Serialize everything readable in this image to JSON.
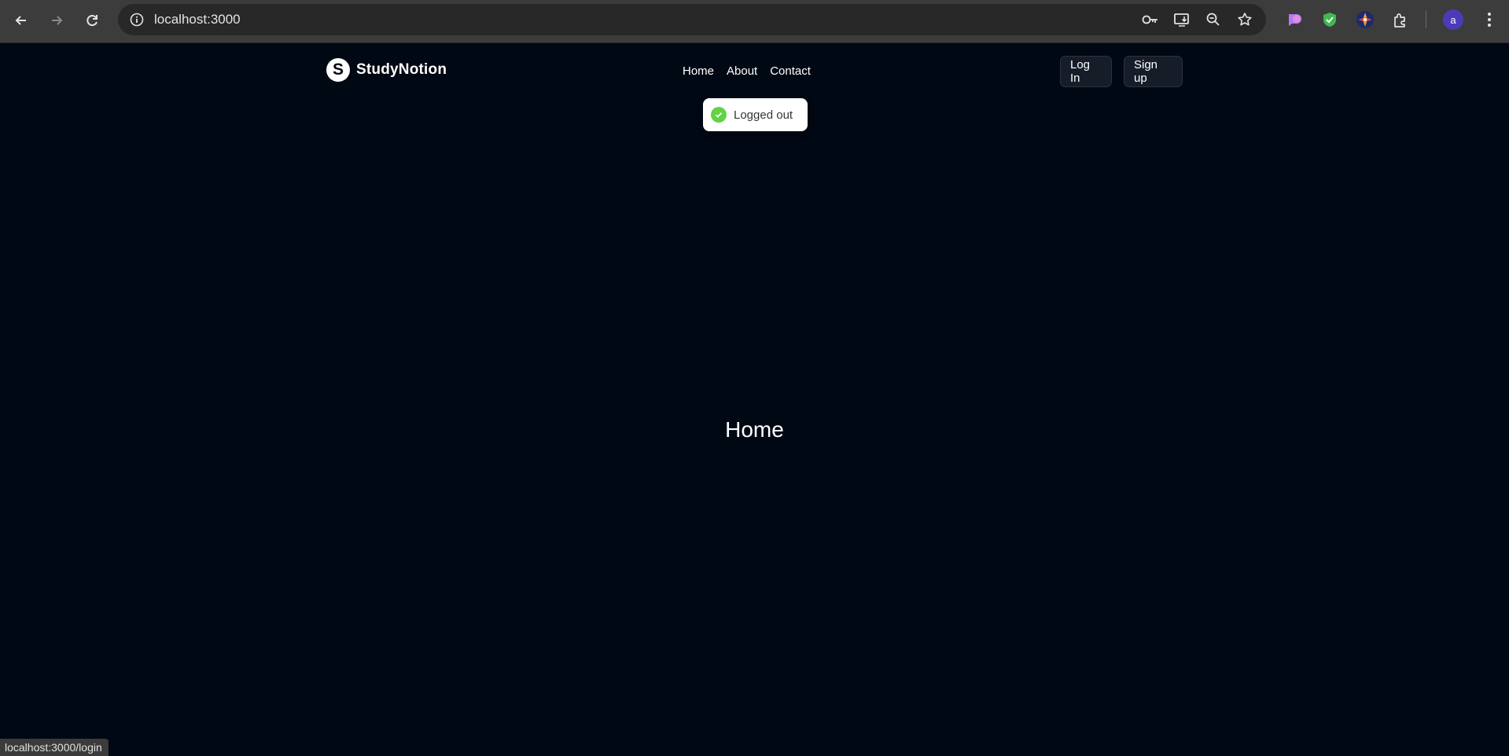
{
  "browser": {
    "url": "localhost:3000",
    "status_url": "localhost:3000/login",
    "profile_initial": "a",
    "icons": [
      "back-icon",
      "forward-icon",
      "reload-icon",
      "info-icon",
      "password-key-icon",
      "install-app-icon",
      "zoom-icon",
      "bookmark-star-icon",
      "extension-icon",
      "menu-icon"
    ]
  },
  "site": {
    "logo_letter": "S",
    "brand": "StudyNotion",
    "nav_links": [
      "Home",
      "About",
      "Contact"
    ],
    "login_label": "Log In",
    "signup_label": "Sign up",
    "heading": "Home"
  },
  "toast": {
    "message": "Logged out",
    "status_color": "#61d345"
  },
  "colors": {
    "page_bg": "#000814",
    "button_bg": "#161d29"
  }
}
